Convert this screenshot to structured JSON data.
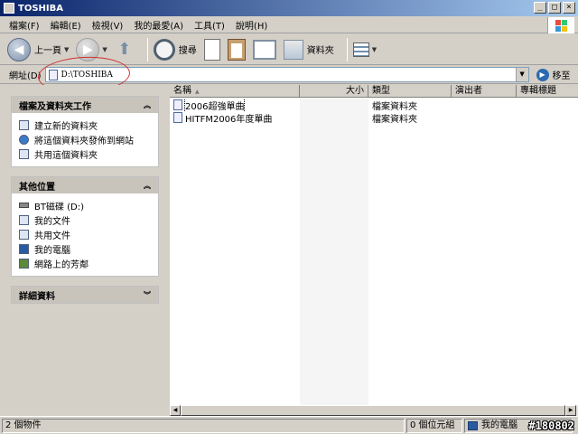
{
  "window": {
    "title": "TOSHIBA",
    "min": "_",
    "max": "□",
    "close": "×"
  },
  "menu": [
    "檔案(F)",
    "編輯(E)",
    "檢視(V)",
    "我的最愛(A)",
    "工具(T)",
    "說明(H)"
  ],
  "toolbar": {
    "back_label": "上一頁",
    "search_label": "搜尋",
    "folders_label": "資料夾"
  },
  "address": {
    "label": "網址(D)",
    "value": "D:\\TOSHIBA",
    "go_label": "移至"
  },
  "tasks": {
    "file_folder": {
      "title": "檔案及資料夾工作",
      "items": [
        "建立新的資料夾",
        "將這個資料夾發佈到網站",
        "共用這個資料夾"
      ]
    },
    "other_places": {
      "title": "其他位置",
      "items": [
        "BT磁碟 (D:)",
        "我的文件",
        "共用文件",
        "我的電腦",
        "網路上的芳鄰"
      ]
    },
    "details": {
      "title": "詳細資料"
    }
  },
  "columns": {
    "name": "名稱",
    "size": "大小",
    "type": "類型",
    "artist": "演出者",
    "album": "專輯標題"
  },
  "files": [
    {
      "name": "2006超強單曲",
      "type": "檔案資料夾"
    },
    {
      "name": "HITFM2006年度單曲",
      "type": "檔案資料夾"
    }
  ],
  "status": {
    "count": "2 個物件",
    "bytes": "0 個位元組",
    "location": "我的電腦"
  },
  "watermark": "#180802"
}
